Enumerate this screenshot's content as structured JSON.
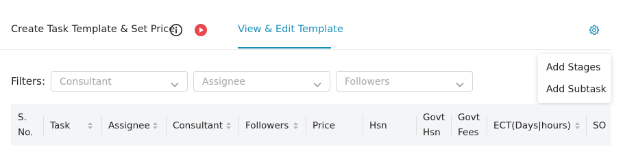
{
  "tabs": {
    "create_template": "Create Task Template & Set Price",
    "view_edit_template": "View & Edit Template"
  },
  "icons": {
    "info": "info-circle-icon",
    "play": "play-circle-icon",
    "gear": "gear-icon",
    "sort": "sort-icon",
    "chevron": "chevron-down-icon"
  },
  "colors": {
    "accent": "#1a8fb8",
    "play_red": "#e8474c"
  },
  "settings_menu": {
    "items": [
      "Add Stages",
      "Add Subtask"
    ]
  },
  "filters": {
    "label": "Filters:",
    "consultant_placeholder": "Consultant",
    "assignee_placeholder": "Assignee",
    "followers_placeholder": "Followers"
  },
  "table": {
    "columns": [
      {
        "lines": [
          "S.",
          "No."
        ],
        "sortable": false
      },
      {
        "lines": [
          "Task"
        ],
        "sortable": true
      },
      {
        "lines": [
          "Assignee"
        ],
        "sortable": true
      },
      {
        "lines": [
          "Consultant"
        ],
        "sortable": true
      },
      {
        "lines": [
          "Followers"
        ],
        "sortable": true
      },
      {
        "lines": [
          "Price"
        ],
        "sortable": false
      },
      {
        "lines": [
          "Hsn"
        ],
        "sortable": false
      },
      {
        "lines": [
          "Govt",
          "Hsn"
        ],
        "sortable": false
      },
      {
        "lines": [
          "Govt",
          "Fees"
        ],
        "sortable": false
      },
      {
        "lines": [
          "ECT(Days|hours)"
        ],
        "sortable": true
      },
      {
        "lines": [
          "SO"
        ],
        "sortable": false
      }
    ]
  }
}
